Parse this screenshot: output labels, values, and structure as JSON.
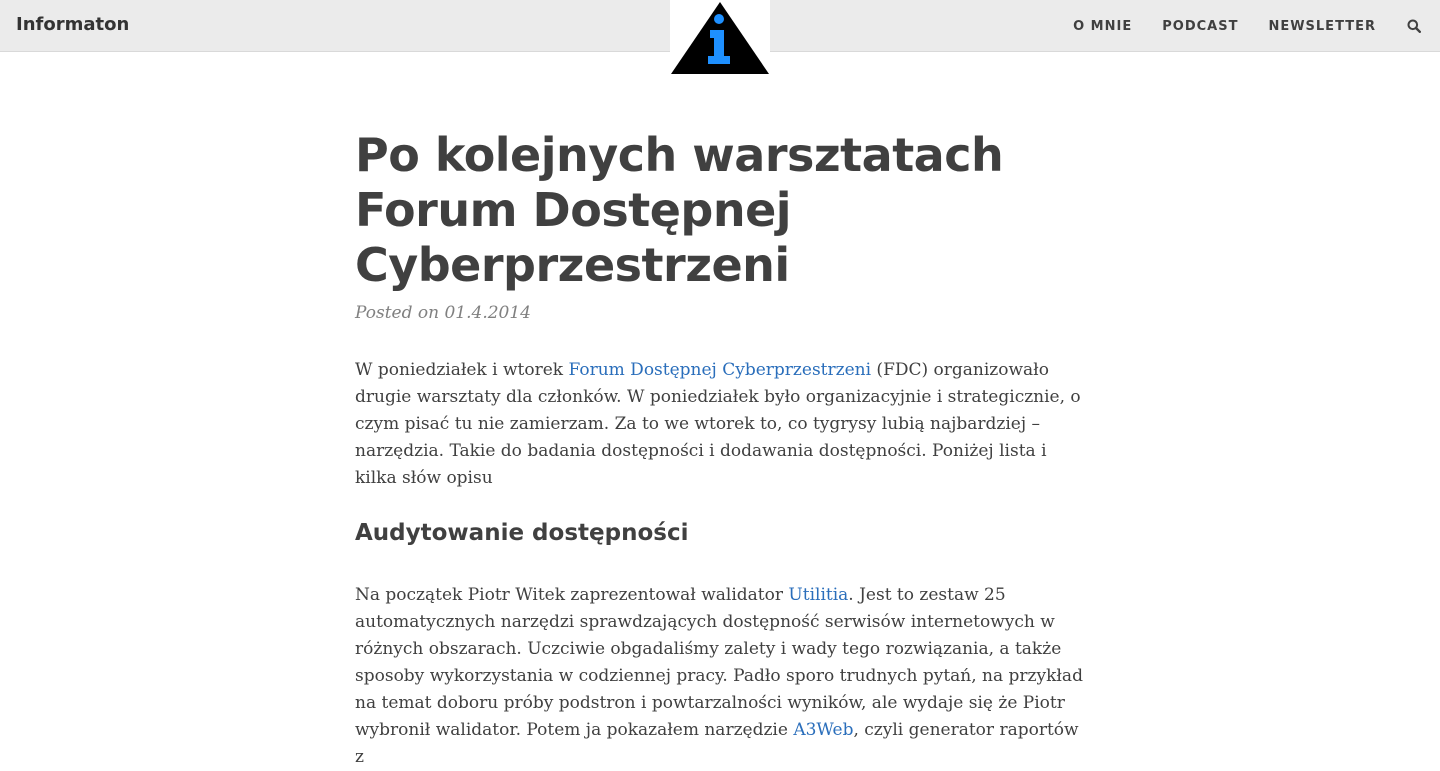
{
  "nav": {
    "brand": "Informaton",
    "links": [
      "O MNIE",
      "PODCAST",
      "NEWSLETTER"
    ],
    "search_icon": "search-icon"
  },
  "logo": {
    "letter": "i",
    "triangle_color": "#000000",
    "letter_color": "#1e90ff"
  },
  "post": {
    "title_line1": "Po kolejnych warsztatach",
    "title_line2": "Forum Dostępnej",
    "title_line3": "Cyberprzestrzeni",
    "meta": "Posted on 01.4.2014"
  },
  "para1": {
    "before_link": "W poniedziałek i wtorek ",
    "link": "Forum Dostępnej Cyberprzestrzeni",
    "after_link": " (FDC) organizowało drugie warsztaty dla członków. W poniedziałek było organizacyjnie i strategicznie, o czym pisać tu nie zamierzam. Za to we wtorek to, co tygrysy lubią najbardziej – narzędzia. Takie do badania dostępności i dodawania dostępności. Poniżej lista i kilka słów opisu"
  },
  "section1": {
    "heading": "Audytowanie dostępności"
  },
  "para2": {
    "before_link1": "Na początek Piotr Witek zaprezentował walidator ",
    "link1": "Utilitia",
    "middle": ". Jest to zestaw 25 automatycznych narzędzi sprawdzających dostępność serwisów internetowych w różnych obszarach. Uczciwie obgadaliśmy zalety i wady tego rozwiązania, a także sposoby wykorzystania w codziennej pracy. Padło sporo trudnych pytań, na przykład na temat doboru próby podstron i powtarzalności wyników, ale wydaje się że Piotr wybronił walidator. Potem ja pokazałem narzędzie ",
    "link2": "A3Web",
    "after_link2": ", czyli generator raportów z"
  },
  "colors": {
    "link": "#2a6ebb",
    "text": "#404040",
    "navbar_bg": "#ebebeb"
  }
}
